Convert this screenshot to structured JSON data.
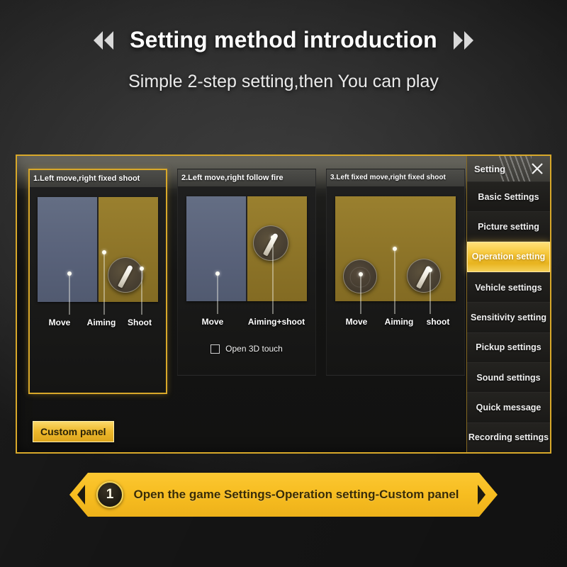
{
  "header": {
    "title": "Setting method introduction",
    "subtitle": "Simple 2-step setting,then You can play",
    "left_chevron_icon": "double-chevron-left-icon",
    "right_chevron_icon": "double-chevron-right-icon"
  },
  "game_panel": {
    "custom_panel_button": "Custom panel",
    "cards": [
      {
        "title": "1.Left move,right fixed shoot",
        "selected": true,
        "layout": "split",
        "labels": [
          "Move",
          "Aiming",
          "Shoot"
        ],
        "checkbox": null
      },
      {
        "title": "2.Left move,right follow fire",
        "selected": false,
        "layout": "split",
        "labels": [
          "Move",
          "Aiming+shoot"
        ],
        "checkbox": {
          "label": "Open 3D touch",
          "checked": false
        }
      },
      {
        "title": "3.Left fixed move,right fixed shoot",
        "selected": false,
        "layout": "full",
        "labels": [
          "Move",
          "Aiming",
          "shoot"
        ],
        "checkbox": null
      }
    ]
  },
  "settings_menu": {
    "header_title": "Setting",
    "close_icon": "close-x-icon",
    "items": [
      {
        "label": "Basic Settings",
        "active": false
      },
      {
        "label": "Picture setting",
        "active": false
      },
      {
        "label": "Operation setting",
        "active": true
      },
      {
        "label": "Vehicle settings",
        "active": false
      },
      {
        "label": "Sensitivity setting",
        "active": false
      },
      {
        "label": "Pickup settings",
        "active": false
      },
      {
        "label": "Sound settings",
        "active": false
      },
      {
        "label": "Quick message",
        "active": false
      },
      {
        "label": "Recording settings",
        "active": false
      }
    ]
  },
  "banner": {
    "step_number": "1",
    "text": "Open the game Settings-Operation setting-Custom panel",
    "left_arrow_icon": "triangle-left-icon",
    "right_arrow_icon": "triangle-right-icon"
  },
  "colors": {
    "accent_gold": "#d8a82a",
    "banner_yellow": "#f7bd20",
    "screen_blue": "#59627a",
    "screen_gold": "#8d7428",
    "background_dark": "#242424"
  }
}
